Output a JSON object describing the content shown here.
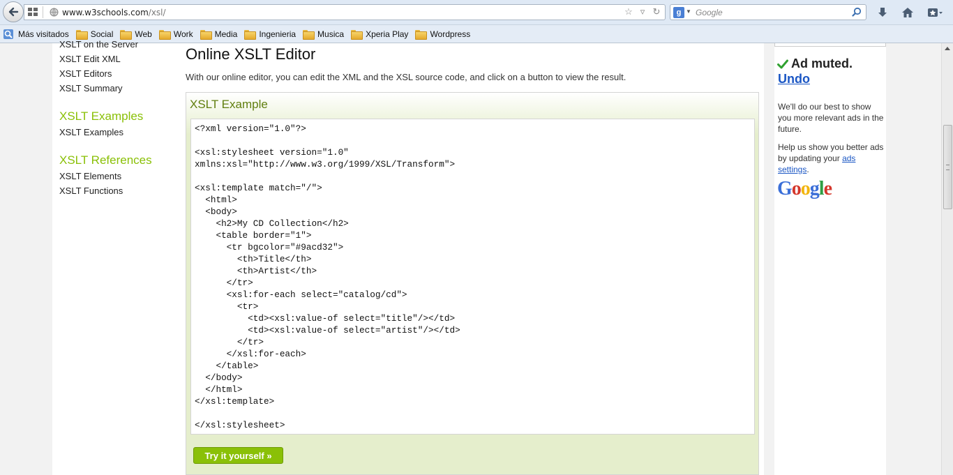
{
  "browser": {
    "url_host": "www.w3schools.com",
    "url_path": "/xsl/",
    "search_placeholder": "Google",
    "bookmarks": [
      "Más visitados",
      "Social",
      "Web",
      "Work",
      "Media",
      "Ingenieria",
      "Musica",
      "Xperia Play",
      "Wordpress"
    ]
  },
  "sidebar": {
    "cut_link": "XSLT on the Server",
    "links_top": [
      "XSLT Edit XML",
      "XSLT Editors",
      "XSLT Summary"
    ],
    "section_examples": "XSLT Examples",
    "links_examples": [
      "XSLT Examples"
    ],
    "section_references": "XSLT References",
    "links_references": [
      "XSLT Elements",
      "XSLT Functions"
    ]
  },
  "main": {
    "title": "Online XSLT Editor",
    "intro": "With our online editor, you can edit the XML and the XSL source code, and click on a button to view the result.",
    "example_title": "XSLT Example",
    "code": "<?xml version=\"1.0\"?>\n\n<xsl:stylesheet version=\"1.0\"\nxmlns:xsl=\"http://www.w3.org/1999/XSL/Transform\">\n\n<xsl:template match=\"/\">\n  <html>\n  <body>\n    <h2>My CD Collection</h2>\n    <table border=\"1\">\n      <tr bgcolor=\"#9acd32\">\n        <th>Title</th>\n        <th>Artist</th>\n      </tr>\n      <xsl:for-each select=\"catalog/cd\">\n        <tr>\n          <td><xsl:value-of select=\"title\"/></td>\n          <td><xsl:value-of select=\"artist\"/></td>\n        </tr>\n      </xsl:for-each>\n    </table>\n  </body>\n  </html>\n</xsl:template>\n\n</xsl:stylesheet>",
    "try_button": "Try it yourself »"
  },
  "ad": {
    "muted": "Ad muted.",
    "undo": "Undo",
    "msg1": "We'll do our best to show you more relevant ads in the future.",
    "msg2_prefix": "Help us show you better ads by updating your ",
    "msg2_link": "ads settings",
    "msg2_suffix": ".",
    "logo_text": "Google"
  },
  "colors": {
    "accent_green": "#8ac007",
    "example_bg": "#e5eecc",
    "example_title": "#617f10",
    "link_blue": "#1a56c4"
  }
}
